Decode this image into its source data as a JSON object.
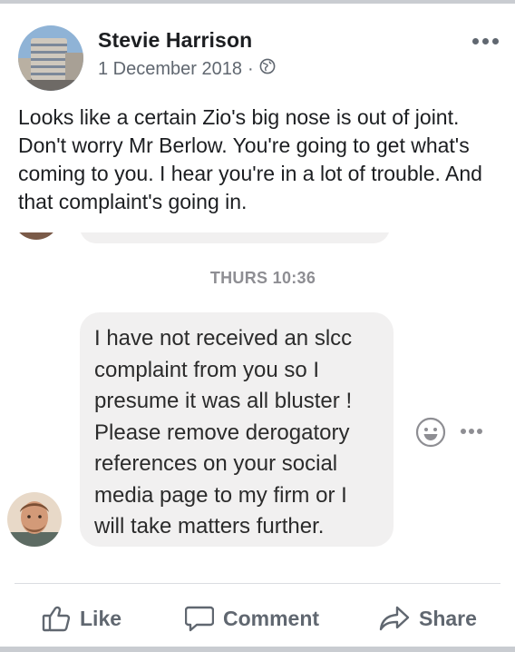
{
  "post": {
    "author": "Stevie Harrison",
    "date": "1 December 2018",
    "separator": "·",
    "privacy_icon": "globe-icon",
    "options_icon": "more-horizontal-icon",
    "text": "Looks like a certain Zio's big nose is out of joint. Don't worry Mr Berlow. You're going to get what's coming to you. I hear you're in a lot of trouble. And that complaint's going in."
  },
  "screenshot": {
    "timestamp": "THURS 10:36",
    "message": "I have not received an slcc\ncomplaint from you so I\npresume it was all bluster !\nPlease remove derogatory\nreferences on your social\nmedia page to my firm or I\nwill take matters further.",
    "react_icon": "smiley-face-icon",
    "more_icon": "more-horizontal-icon"
  },
  "actions": {
    "like": "Like",
    "comment": "Comment",
    "share": "Share"
  },
  "colors": {
    "background": "#ffffff",
    "meta_text": "#606770",
    "bubble": "#f1f0f0",
    "timestamp": "#8e8e93"
  }
}
